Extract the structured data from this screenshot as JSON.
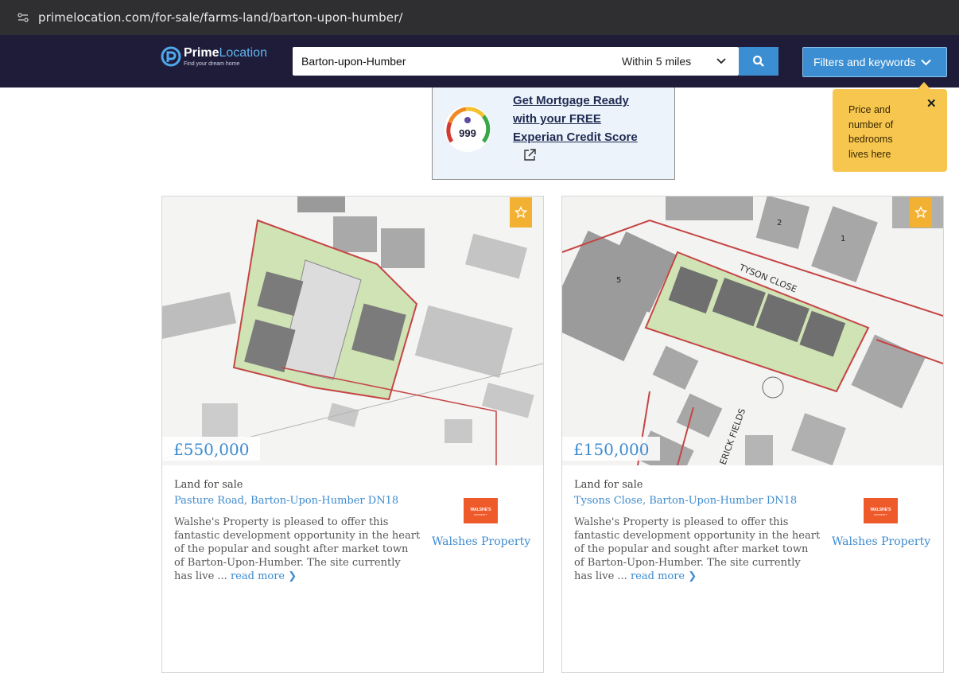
{
  "browser": {
    "url": "primelocation.com/for-sale/farms-land/barton-upon-humber/"
  },
  "header": {
    "logo_brand_bold": "Prime",
    "logo_brand_light": "Location",
    "logo_tagline": "Find your dream home",
    "search_value": "Barton-upon-Humber",
    "radius_value": "Within 5 miles",
    "filters_label": "Filters and keywords"
  },
  "ad": {
    "score": "999",
    "line1": "Get Mortgage Ready",
    "line2": "with your FREE",
    "line3": "Experian Credit Score",
    "icon": "external-link-icon"
  },
  "tooltip": {
    "text": "Price and number of bedrooms lives here",
    "close": "✕"
  },
  "listings": [
    {
      "price": "£550,000",
      "type": "Land for sale",
      "address": "Pasture Road, Barton-Upon-Humber DN18",
      "description": "Walshe's Property is pleased to offer this fantastic development opportunity in the heart of the popular and sought after market town of Barton-Upon-Humber. The site currently has live ...",
      "read_more": "read more",
      "agent": "Walshes Property",
      "agent_logo_text": "WALSHE'S",
      "agent_logo_sub": "PROPERTY"
    },
    {
      "price": "£150,000",
      "type": "Land for sale",
      "address": "Tysons Close, Barton-Upon-Humber DN18",
      "description": "Walshe's Property is pleased to offer this fantastic development opportunity in the heart of the popular and sought after market town of Barton-Upon-Humber. The site currently has live ...",
      "read_more": "read more",
      "agent": "Walshes Property",
      "agent_logo_text": "WALSHE'S",
      "agent_logo_sub": "PROPERTY",
      "map_labels": [
        "TYSON CLOSE",
        "ERICK FIELDS",
        "5",
        "2",
        "1"
      ]
    }
  ],
  "colors": {
    "nav": "#1f1c3a",
    "accent": "#3b8ed2",
    "link": "#3d8bcf",
    "save": "#f2b133",
    "tooltip": "#f6c64f"
  }
}
